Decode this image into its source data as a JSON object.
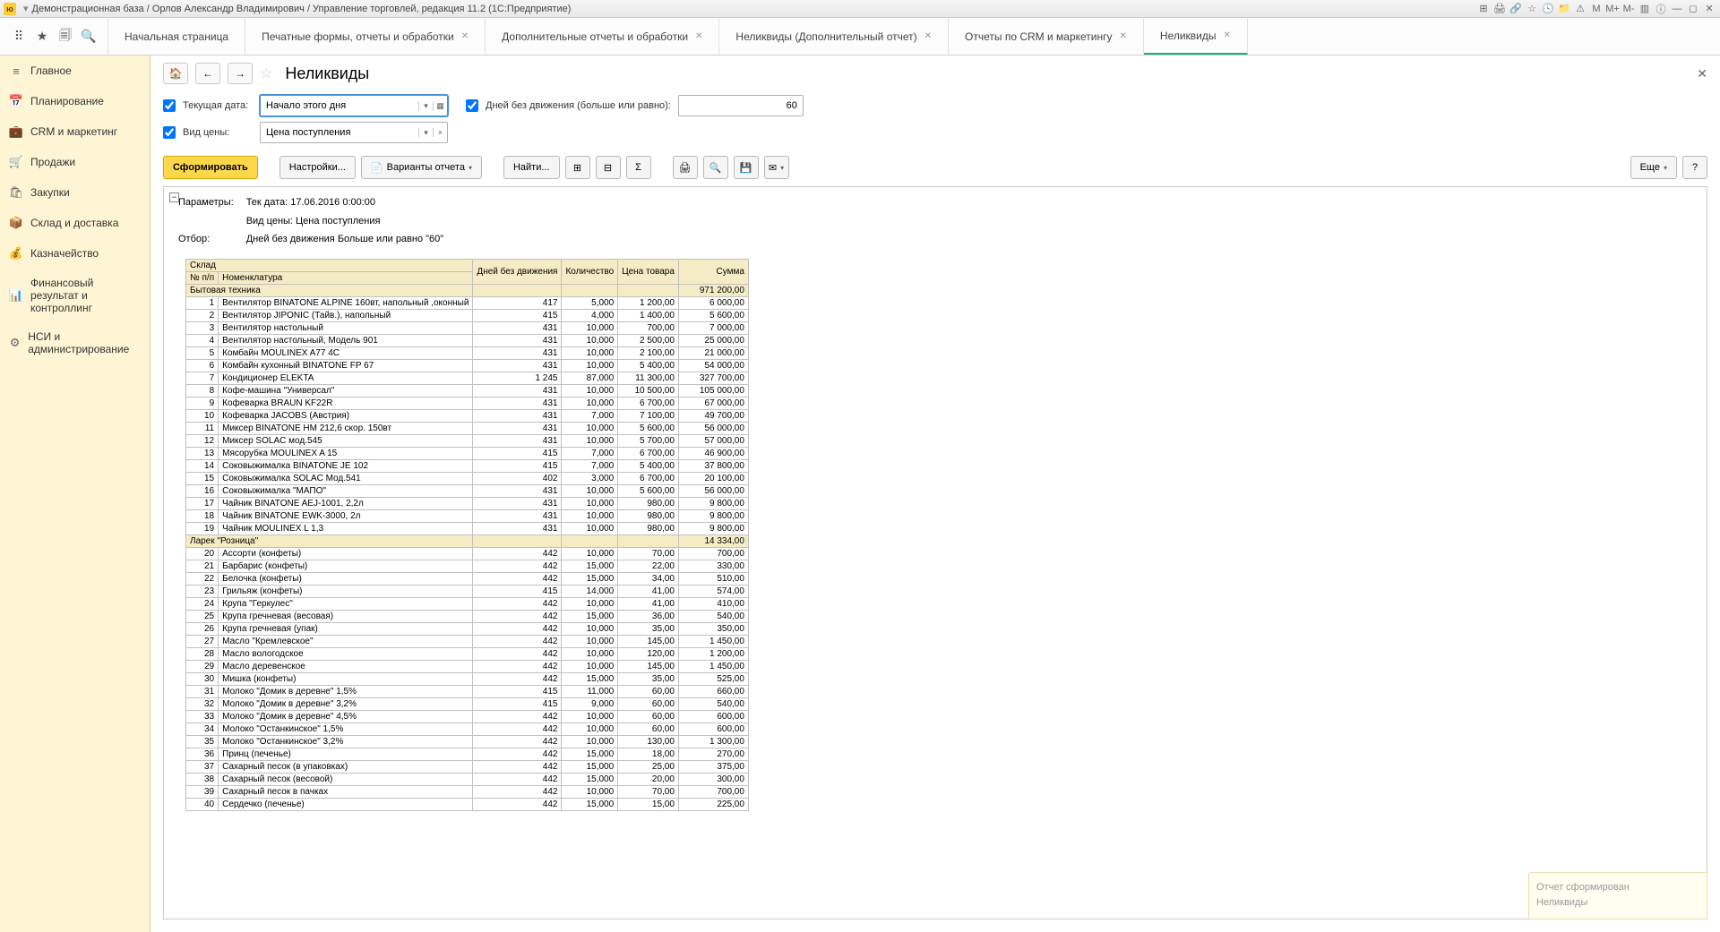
{
  "titlebar": {
    "app": "ю",
    "title": "Демонстрационная база / Орлов Александр Владимирович / Управление торговлей, редакция 11.2 (1С:Предприятие)"
  },
  "tabs": [
    "Начальная страница",
    "Печатные формы, отчеты и обработки",
    "Дополнительные отчеты и обработки",
    "Неликвиды (Дополнительный отчет)",
    "Отчеты по CRM и маркетингу",
    "Неликвиды"
  ],
  "active_tab": 5,
  "sidebar": [
    {
      "icon": "≡",
      "label": "Главное"
    },
    {
      "icon": "📅",
      "label": "Планирование"
    },
    {
      "icon": "💼",
      "label": "CRM и маркетинг"
    },
    {
      "icon": "🛒",
      "label": "Продажи"
    },
    {
      "icon": "🛍",
      "label": "Закупки"
    },
    {
      "icon": "📦",
      "label": "Склад и доставка"
    },
    {
      "icon": "💰",
      "label": "Казначейство"
    },
    {
      "icon": "📊",
      "label": "Финансовый результат и контроллинг"
    },
    {
      "icon": "⚙",
      "label": "НСИ и администрирование"
    }
  ],
  "page_title": "Неликвиды",
  "filters": {
    "date_label": "Текущая дата:",
    "date_value": "Начало этого дня",
    "days_label": "Дней без движения (больше или равно):",
    "days_value": "60",
    "price_label": "Вид цены:",
    "price_value": "Цена поступления"
  },
  "toolbar": {
    "generate": "Сформировать",
    "settings": "Настройки...",
    "variants": "Варианты отчета",
    "find": "Найти...",
    "more": "Еще"
  },
  "params": {
    "p_label": "Параметры:",
    "p1": "Тек дата: 17.06.2016 0:00:00",
    "p2": "Вид цены: Цена поступления",
    "f_label": "Отбор:",
    "f1": "Дней без движения Больше или равно \"60\""
  },
  "columns": {
    "warehouse": "Склад",
    "num": "№ п/п",
    "nom": "Номенклатура",
    "days": "Дней без движения",
    "qty": "Количество",
    "price": "Цена товара",
    "sum": "Сумма"
  },
  "groups": [
    {
      "name": "Бытовая техника",
      "sum": "971 200,00",
      "rows": [
        {
          "n": "1",
          "name": "Вентилятор BINATONE ALPINE 160вт, напольный ,оконный",
          "d": "417",
          "q": "5,000",
          "p": "1 200,00",
          "s": "6 000,00"
        },
        {
          "n": "2",
          "name": "Вентилятор JIPONIC (Тайв.), напольный",
          "d": "415",
          "q": "4,000",
          "p": "1 400,00",
          "s": "5 600,00"
        },
        {
          "n": "3",
          "name": "Вентилятор настольный",
          "d": "431",
          "q": "10,000",
          "p": "700,00",
          "s": "7 000,00"
        },
        {
          "n": "4",
          "name": "Вентилятор настольный, Модель 901",
          "d": "431",
          "q": "10,000",
          "p": "2 500,00",
          "s": "25 000,00"
        },
        {
          "n": "5",
          "name": "Комбайн MOULINEX  A77 4C",
          "d": "431",
          "q": "10,000",
          "p": "2 100,00",
          "s": "21 000,00"
        },
        {
          "n": "6",
          "name": "Комбайн кухонный BINATONE FP 67",
          "d": "431",
          "q": "10,000",
          "p": "5 400,00",
          "s": "54 000,00"
        },
        {
          "n": "7",
          "name": "Кондиционер ELEKTA",
          "d": "1 245",
          "q": "87,000",
          "p": "11 300,00",
          "s": "327 700,00"
        },
        {
          "n": "8",
          "name": "Кофе-машина \"Универсал\"",
          "d": "431",
          "q": "10,000",
          "p": "10 500,00",
          "s": "105 000,00"
        },
        {
          "n": "9",
          "name": "Кофеварка BRAUN KF22R",
          "d": "431",
          "q": "10,000",
          "p": "6 700,00",
          "s": "67 000,00"
        },
        {
          "n": "10",
          "name": "Кофеварка JACOBS (Австрия)",
          "d": "431",
          "q": "7,000",
          "p": "7 100,00",
          "s": "49 700,00"
        },
        {
          "n": "11",
          "name": "Миксер BINATONE HM 212,6 скор. 150вт",
          "d": "431",
          "q": "10,000",
          "p": "5 600,00",
          "s": "56 000,00"
        },
        {
          "n": "12",
          "name": "Миксер SOLAC мод.545",
          "d": "431",
          "q": "10,000",
          "p": "5 700,00",
          "s": "57 000,00"
        },
        {
          "n": "13",
          "name": "Мясорубка MOULINEX  A 15",
          "d": "415",
          "q": "7,000",
          "p": "6 700,00",
          "s": "46 900,00"
        },
        {
          "n": "14",
          "name": "Соковыжималка  BINATONE JE 102",
          "d": "415",
          "q": "7,000",
          "p": "5 400,00",
          "s": "37 800,00"
        },
        {
          "n": "15",
          "name": "Соковыжималка  SOLAC  Мод.541",
          "d": "402",
          "q": "3,000",
          "p": "6 700,00",
          "s": "20 100,00"
        },
        {
          "n": "16",
          "name": "Соковыжималка \"МАПО\"",
          "d": "431",
          "q": "10,000",
          "p": "5 600,00",
          "s": "56 000,00"
        },
        {
          "n": "17",
          "name": "Чайник BINATONE  AEJ-1001,  2,2л",
          "d": "431",
          "q": "10,000",
          "p": "980,00",
          "s": "9 800,00"
        },
        {
          "n": "18",
          "name": "Чайник BINATONE  EWK-3000,  2л",
          "d": "431",
          "q": "10,000",
          "p": "980,00",
          "s": "9 800,00"
        },
        {
          "n": "19",
          "name": "Чайник MOULINEX L 1,3",
          "d": "431",
          "q": "10,000",
          "p": "980,00",
          "s": "9 800,00"
        }
      ]
    },
    {
      "name": "Ларек \"Розница\"",
      "sum": "14 334,00",
      "rows": [
        {
          "n": "20",
          "name": "Ассорти (конфеты)",
          "d": "442",
          "q": "10,000",
          "p": "70,00",
          "s": "700,00"
        },
        {
          "n": "21",
          "name": "Барбарис (конфеты)",
          "d": "442",
          "q": "15,000",
          "p": "22,00",
          "s": "330,00"
        },
        {
          "n": "22",
          "name": "Белочка (конфеты)",
          "d": "442",
          "q": "15,000",
          "p": "34,00",
          "s": "510,00"
        },
        {
          "n": "23",
          "name": "Грильяж (конфеты)",
          "d": "415",
          "q": "14,000",
          "p": "41,00",
          "s": "574,00"
        },
        {
          "n": "24",
          "name": "Крупа \"Геркулес\"",
          "d": "442",
          "q": "10,000",
          "p": "41,00",
          "s": "410,00"
        },
        {
          "n": "25",
          "name": "Крупа гречневая (весовая)",
          "d": "442",
          "q": "15,000",
          "p": "36,00",
          "s": "540,00"
        },
        {
          "n": "26",
          "name": "Крупа гречневая (упак)",
          "d": "442",
          "q": "10,000",
          "p": "35,00",
          "s": "350,00"
        },
        {
          "n": "27",
          "name": "Масло \"Кремлевское\"",
          "d": "442",
          "q": "10,000",
          "p": "145,00",
          "s": "1 450,00"
        },
        {
          "n": "28",
          "name": "Масло вологодское",
          "d": "442",
          "q": "10,000",
          "p": "120,00",
          "s": "1 200,00"
        },
        {
          "n": "29",
          "name": "Масло деревенское",
          "d": "442",
          "q": "10,000",
          "p": "145,00",
          "s": "1 450,00"
        },
        {
          "n": "30",
          "name": "Мишка (конфеты)",
          "d": "442",
          "q": "15,000",
          "p": "35,00",
          "s": "525,00"
        },
        {
          "n": "31",
          "name": "Молоко \"Домик в деревне\" 1,5%",
          "d": "415",
          "q": "11,000",
          "p": "60,00",
          "s": "660,00"
        },
        {
          "n": "32",
          "name": "Молоко \"Домик в деревне\" 3,2%",
          "d": "415",
          "q": "9,000",
          "p": "60,00",
          "s": "540,00"
        },
        {
          "n": "33",
          "name": "Молоко \"Домик в деревне\" 4,5%",
          "d": "442",
          "q": "10,000",
          "p": "60,00",
          "s": "600,00"
        },
        {
          "n": "34",
          "name": "Молоко \"Останкинское\" 1,5%",
          "d": "442",
          "q": "10,000",
          "p": "60,00",
          "s": "600,00"
        },
        {
          "n": "35",
          "name": "Молоко \"Останкинское\" 3,2%",
          "d": "442",
          "q": "10,000",
          "p": "130,00",
          "s": "1 300,00"
        },
        {
          "n": "36",
          "name": "Принц (печенье)",
          "d": "442",
          "q": "15,000",
          "p": "18,00",
          "s": "270,00"
        },
        {
          "n": "37",
          "name": "Сахарный песок (в упаковках)",
          "d": "442",
          "q": "15,000",
          "p": "25,00",
          "s": "375,00"
        },
        {
          "n": "38",
          "name": "Сахарный песок (весовой)",
          "d": "442",
          "q": "15,000",
          "p": "20,00",
          "s": "300,00"
        },
        {
          "n": "39",
          "name": "Сахарный песок в пачках",
          "d": "442",
          "q": "10,000",
          "p": "70,00",
          "s": "700,00"
        },
        {
          "n": "40",
          "name": "Сердечко (печенье)",
          "d": "442",
          "q": "15,000",
          "p": "15,00",
          "s": "225,00"
        }
      ]
    }
  ],
  "notif": {
    "line1": "Отчет сформирован",
    "line2": "Неликвиды"
  }
}
